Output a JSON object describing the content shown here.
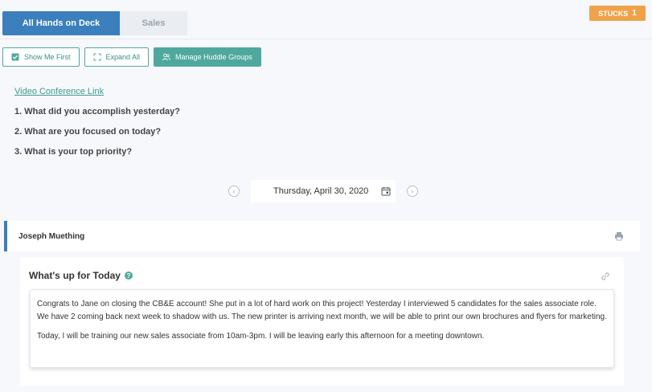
{
  "tabs": [
    {
      "label": "All Hands on Deck"
    },
    {
      "label": "Sales"
    }
  ],
  "stucks": {
    "label": "STUCKS",
    "count": "1",
    "color": "#f0a24a"
  },
  "toolbar": {
    "show_me_first": "Show Me First",
    "expand_all": "Expand All",
    "manage_groups": "Manage Huddle Groups"
  },
  "video_link": "Video Conference Link",
  "questions": [
    "1. What did you accomplish yesterday?",
    "2. What are you focused on today?",
    "3. What is your top priority?"
  ],
  "date": "Thursday, April 30, 2020",
  "person": {
    "name": "Joseph Muething"
  },
  "card": {
    "title": "What's up for Today",
    "help": "?",
    "paragraphs": [
      "Congrats to Jane on closing the CB&E account! She put in a lot of hard work on this project! Yesterday I interviewed 5 candidates for the sales associate role. We have 2 coming back next week to shadow with us. The new printer is arriving next month, we will be able to print our own brochures and flyers for marketing.",
      "Today, I will be training our new sales associate from 10am-3pm. I will be leaving early this afternoon for a meeting downtown."
    ]
  },
  "colors": {
    "primary": "#3b7fbd",
    "accent": "#4fa89d",
    "warning": "#f0a24a"
  }
}
